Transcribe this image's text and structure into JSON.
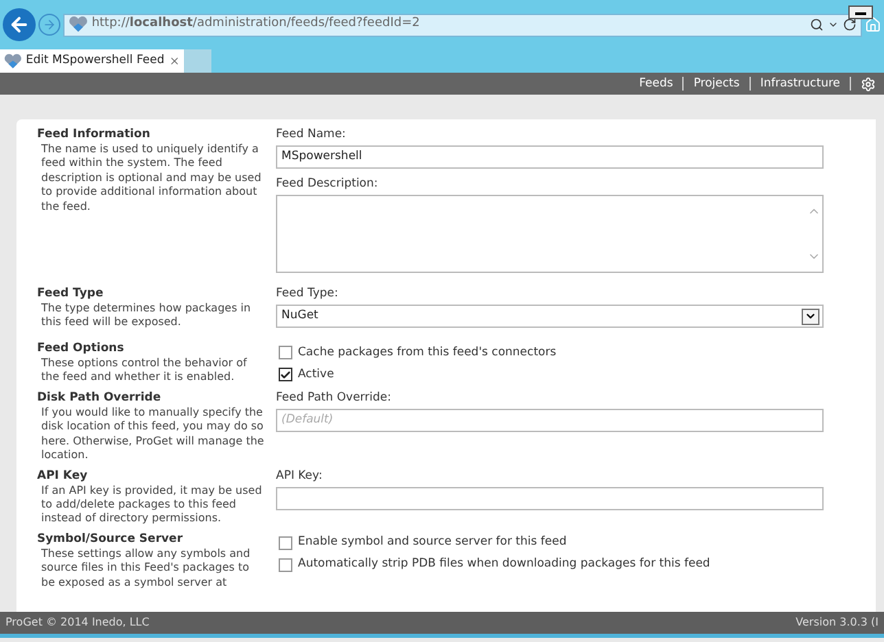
{
  "browser": {
    "url": "http://**localhost**/administration/feeds/feed?feedId=2",
    "tab_title": "Edit MSpowershell Feed"
  },
  "nav": [
    "Feeds",
    "Projects",
    "Infrastructure"
  ],
  "sections": [
    {
      "title": "Feed Information",
      "description": "The name is used to uniquely identify a feed within the system. The feed description is optional and may be used to provide additional information about the feed.",
      "fields": [
        {
          "kind": "text",
          "label": "Feed Name:",
          "value": "MSpowershell"
        },
        {
          "kind": "textarea",
          "label": "Feed Description:"
        }
      ]
    },
    {
      "title": "Feed Type",
      "description": "The type determines how packages in this feed will be exposed.",
      "fields": [
        {
          "kind": "select",
          "label": "Feed Type:",
          "value": "NuGet"
        }
      ]
    },
    {
      "title": "Feed Options",
      "description": "These options control the behavior of the feed and whether it is enabled.",
      "fields": [
        {
          "kind": "checkbox",
          "label": "Cache packages from this feed's connectors",
          "checked": false
        },
        {
          "kind": "checkbox",
          "label": "Active",
          "checked": true
        }
      ]
    },
    {
      "title": "Disk Path Override",
      "description": "If you would like to manually specify the disk location of this feed, you may do so here. Otherwise, ProGet will manage the location.",
      "fields": [
        {
          "kind": "text",
          "label": "Feed Path Override:",
          "placeholder": "(Default)"
        }
      ]
    },
    {
      "title": "API Key",
      "description": "If an API key is provided, it may be used to add/delete packages to this feed instead of directory permissions.",
      "fields": [
        {
          "kind": "text",
          "label": "API Key:"
        }
      ]
    },
    {
      "title": "Symbol/Source Server",
      "description": "These settings allow any symbols and source files in this Feed's packages to be exposed as a symbol server at",
      "fields": [
        {
          "kind": "checkbox",
          "label": "Enable symbol and source server for this feed",
          "checked": false
        },
        {
          "kind": "checkbox",
          "label": "Automatically strip PDB files when downloading packages for this feed",
          "checked": false
        }
      ]
    }
  ],
  "footer": {
    "left": "ProGet © 2014 Inedo, LLC",
    "right": "Version 3.0.3 (I"
  }
}
